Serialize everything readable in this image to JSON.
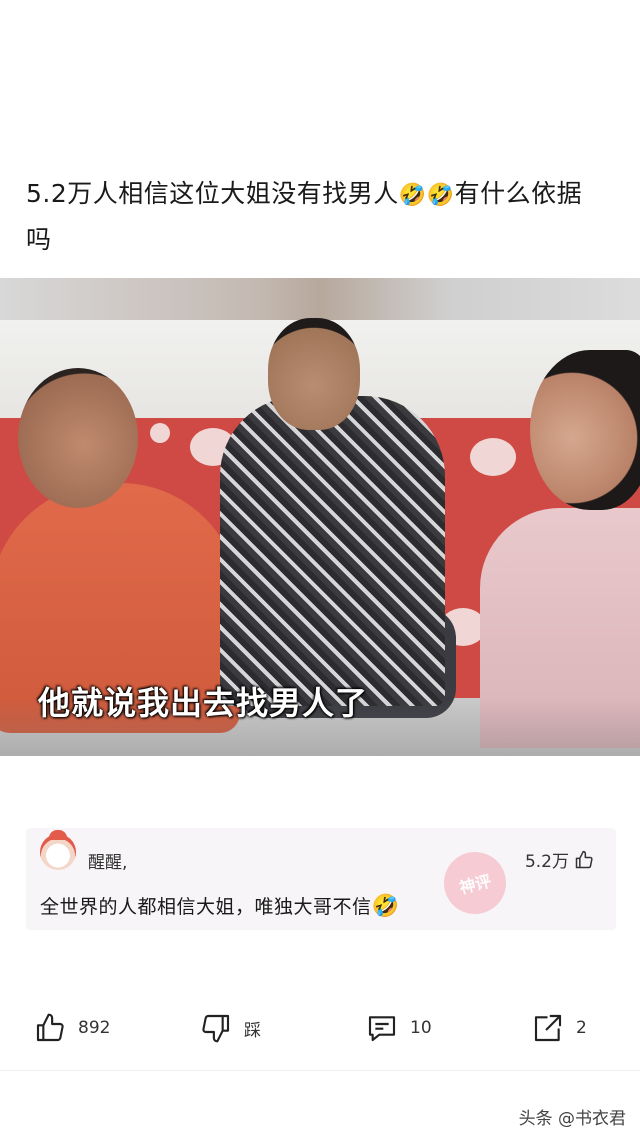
{
  "post": {
    "title_line1": "5.2万人相信这位大姐没有找男人",
    "title_emoji": "🤣🤣",
    "title_line1_tail": "有什么依据",
    "title_line2": "吗"
  },
  "video": {
    "subtitle": "他就说我出去找男人了"
  },
  "comment": {
    "username": "醒醒,",
    "likes": "5.2万",
    "text": "全世界的人都相信大姐，唯独大哥不信",
    "text_emoji": "🤣",
    "stamp_label": "神评"
  },
  "actions": {
    "like_count": "892",
    "dislike_label": "踩",
    "comment_count": "10",
    "share_count": "2"
  },
  "watermark": "头条 @书衣君",
  "icons": [
    "thumb-up-icon",
    "thumb-down-icon",
    "comment-icon",
    "share-icon"
  ]
}
